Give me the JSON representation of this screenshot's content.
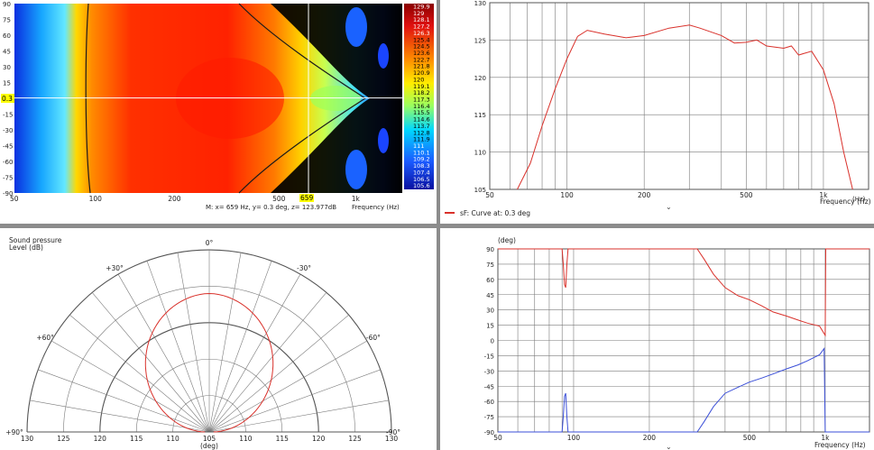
{
  "colors": {
    "grid": "#7a7a7a",
    "spl_curve": "#d9312b",
    "phase_curve_red": "#d9312b",
    "phase_curve_blue": "#3b4fd8",
    "splitter": "#8c8c8c",
    "cursor_label_bg": "#ffff00"
  },
  "chart_data": [
    {
      "id": "sonogram",
      "type": "heatmap",
      "xlabel": "Frequency  (Hz)",
      "x_scale": "log",
      "xlim": [
        50,
        1500
      ],
      "x_ticks": [
        "50",
        "100",
        "200",
        "500",
        "1k"
      ],
      "ylim": [
        -90,
        90
      ],
      "y_ticks": [
        "90",
        "75",
        "60",
        "45",
        "30",
        "15",
        "0",
        "-15",
        "-30",
        "-45",
        "-60",
        "-75",
        "-90"
      ],
      "cursor": {
        "x_label": "659",
        "y_label": "0.3",
        "x": 659,
        "y": 0.3
      },
      "readout": "M:  x= 659 Hz,  y= 0.3 deg,  z= 123.977dB",
      "colorbar_labels": [
        "129.9",
        "129",
        "128.1",
        "127.2",
        "126.3",
        "125.4",
        "124.5",
        "123.6",
        "122.7",
        "121.8",
        "120.9",
        "120",
        "119.1",
        "118.2",
        "117.3",
        "116.4",
        "115.5",
        "114.6",
        "113.7",
        "112.8",
        "111.9",
        "111",
        "110.1",
        "109.2",
        "108.3",
        "107.4",
        "106.5",
        "105.6"
      ]
    },
    {
      "id": "spl-curve",
      "type": "line",
      "xlabel": "Frequency  (Hz)",
      "x_scale": "log",
      "xlim": [
        50,
        1500
      ],
      "x_ticks": [
        "50",
        "100",
        "200",
        "500",
        "1k",
        "(Hz)"
      ],
      "ylim": [
        105,
        130
      ],
      "y_ticks": [
        "130",
        "125",
        "120",
        "115",
        "110",
        "105"
      ],
      "legend": "sF: Curve at: 0.3 deg",
      "series": [
        {
          "name": "sF: Curve at: 0.3 deg",
          "x": [
            64,
            72,
            80,
            90,
            100,
            110,
            120,
            140,
            170,
            200,
            250,
            300,
            330,
            400,
            450,
            500,
            550,
            600,
            700,
            750,
            800,
            900,
            1000,
            1100,
            1200,
            1300
          ],
          "values": [
            105,
            108.5,
            113.5,
            118.5,
            122.5,
            125.5,
            126.3,
            125.8,
            125.3,
            125.6,
            126.6,
            127,
            126.6,
            125.6,
            124.6,
            124.7,
            125,
            124.2,
            123.9,
            124.2,
            123,
            123.5,
            121,
            116.5,
            110,
            105
          ]
        }
      ]
    },
    {
      "id": "polar",
      "type": "polar",
      "title_line1": "Sound pressure",
      "title_line2": "Level (dB)",
      "angle_labels": [
        "0°",
        "+30°",
        "-30°",
        "+60°",
        "-60°",
        "+90°",
        "-90°"
      ],
      "radial_labels_left": [
        "130",
        "125",
        "120",
        "115",
        "110",
        "105"
      ],
      "radial_labels_right": [
        "110",
        "115",
        "120",
        "125",
        "130"
      ],
      "radial_range": [
        105,
        130
      ],
      "unit": "(deg)",
      "center_label": "0",
      "series": [
        {
          "name": "",
          "radius_at_0_deg": 124,
          "radius_at_90_deg": 116
        }
      ]
    },
    {
      "id": "phase-curve",
      "type": "line",
      "ylabel": "(deg)",
      "xlabel": "Frequency  (Hz)",
      "x_scale": "log",
      "xlim": [
        50,
        1500
      ],
      "x_ticks": [
        "50",
        "100",
        "200",
        "500",
        "1k"
      ],
      "ylim": [
        -90,
        90
      ],
      "y_ticks": [
        "90",
        "75",
        "60",
        "45",
        "30",
        "15",
        "0",
        "-15",
        "-30",
        "-45",
        "-60",
        "-75",
        "-90"
      ],
      "series": [
        {
          "name": "",
          "x": [
            50,
            90,
            91,
            92,
            93,
            94,
            95,
            310,
            330,
            360,
            400,
            450,
            500,
            560,
            620,
            700,
            780,
            850,
            950,
            1000,
            1005,
            1010,
            1020,
            1500
          ],
          "values": [
            90,
            90,
            75,
            55,
            52,
            75,
            90,
            90,
            80,
            65,
            52,
            44,
            40,
            34,
            28,
            24,
            20,
            17,
            14,
            5,
            90,
            90,
            90,
            90
          ]
        },
        {
          "name": "",
          "x": [
            50,
            90,
            91,
            92,
            93,
            94,
            95,
            310,
            330,
            360,
            400,
            450,
            500,
            560,
            620,
            700,
            780,
            850,
            950,
            990,
            1000,
            1005,
            1010,
            1500
          ],
          "values": [
            -90,
            -90,
            -75,
            -55,
            -52,
            -75,
            -90,
            -90,
            -80,
            -65,
            -52,
            -46,
            -41,
            -37,
            -33,
            -28,
            -24,
            -20,
            -14,
            -8,
            -90,
            -90,
            -90,
            -90
          ]
        }
      ]
    }
  ]
}
